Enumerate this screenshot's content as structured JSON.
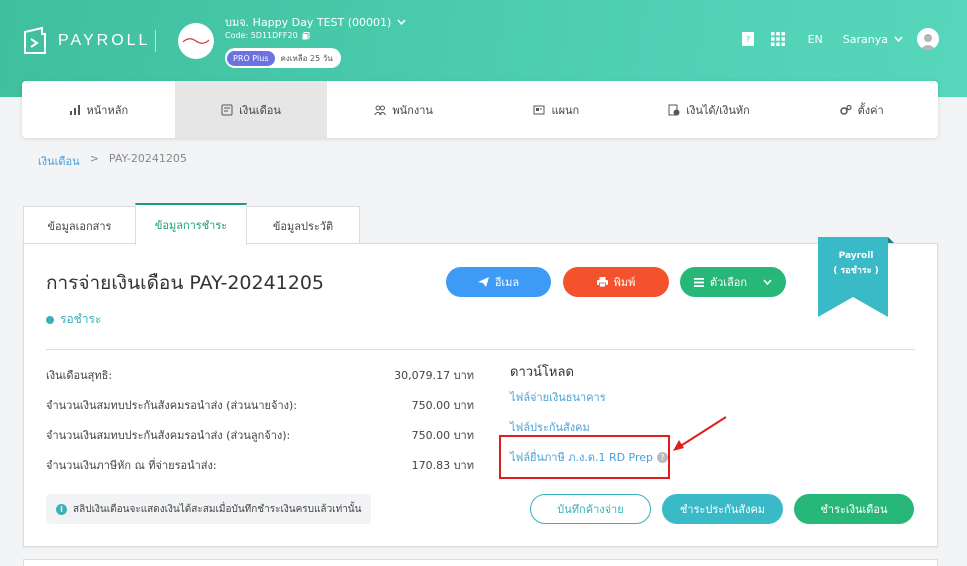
{
  "header": {
    "logo_text": "PAYROLL",
    "company_name": "บมจ. Happy Day TEST (00001)",
    "company_code": "Code: 5D11DFF20",
    "plan_label": "PRO Plus",
    "plan_days": "คงเหลือ 25 วัน",
    "language": "EN",
    "user_name": "Saranya"
  },
  "nav": {
    "items": [
      {
        "label": "หน้าหลัก",
        "icon": "chart-icon"
      },
      {
        "label": "เงินเดือน",
        "icon": "payroll-icon"
      },
      {
        "label": "พนักงาน",
        "icon": "people-icon"
      },
      {
        "label": "แผนก",
        "icon": "department-icon"
      },
      {
        "label": "เงินได้/เงินหัก",
        "icon": "income-icon"
      },
      {
        "label": "ตั้งค่า",
        "icon": "gear-icon"
      }
    ]
  },
  "breadcrumb": {
    "parent": "เงินเดือน",
    "separator": ">",
    "current": "PAY-20241205"
  },
  "tabs": [
    "ข้อมูลเอกสาร",
    "ข้อมูลการชำระ",
    "ข้อมูลประวัติ"
  ],
  "card": {
    "title": "การจ่ายเงินเดือน PAY-20241205",
    "status": "รอชำระ",
    "ribbon_line1": "Payroll",
    "ribbon_line2": "( รอชำระ )"
  },
  "actions": {
    "email": "อีเมล",
    "print": "พิมพ์",
    "options": "ตัวเลือก"
  },
  "summary": [
    {
      "label": "เงินเดือนสุทธิ:",
      "value": "30,079.17 บาท"
    },
    {
      "label": "จำนวนเงินสมทบประกันสังคมรอนำส่ง (ส่วนนายจ้าง):",
      "value": "750.00 บาท"
    },
    {
      "label": "จำนวนเงินสมทบประกันสังคมรอนำส่ง (ส่วนลูกจ้าง):",
      "value": "750.00 บาท"
    },
    {
      "label": "จำนวนเงินภาษีหัก ณ ที่จ่ายรอนำส่ง:",
      "value": "170.83 บาท"
    }
  ],
  "downloads": {
    "title": "ดาวน์โหลด",
    "links": [
      "ไฟล์จ่ายเงินธนาคาร",
      "ไฟล์ประกันสังคม",
      "ไฟล์ยื่นภาษี ภ.ง.ด.1 RD Prep"
    ]
  },
  "note": "สลิปเงินเดือนจะแสดงเงินได้สะสมเมื่อบันทึกชำระเงินครบแล้วเท่านั้น",
  "bottom_actions": {
    "record": "บันทึกค้างจ่าย",
    "social_security": "ชำระประกันสังคม",
    "pay_salary": "ชำระเงินเดือน"
  },
  "colors": {
    "brand": "#4ecfb2",
    "email": "#3d9af5",
    "print": "#f4522c",
    "options": "#27b779",
    "status": "#3ab0b8",
    "highlight": "#e01e1e"
  }
}
